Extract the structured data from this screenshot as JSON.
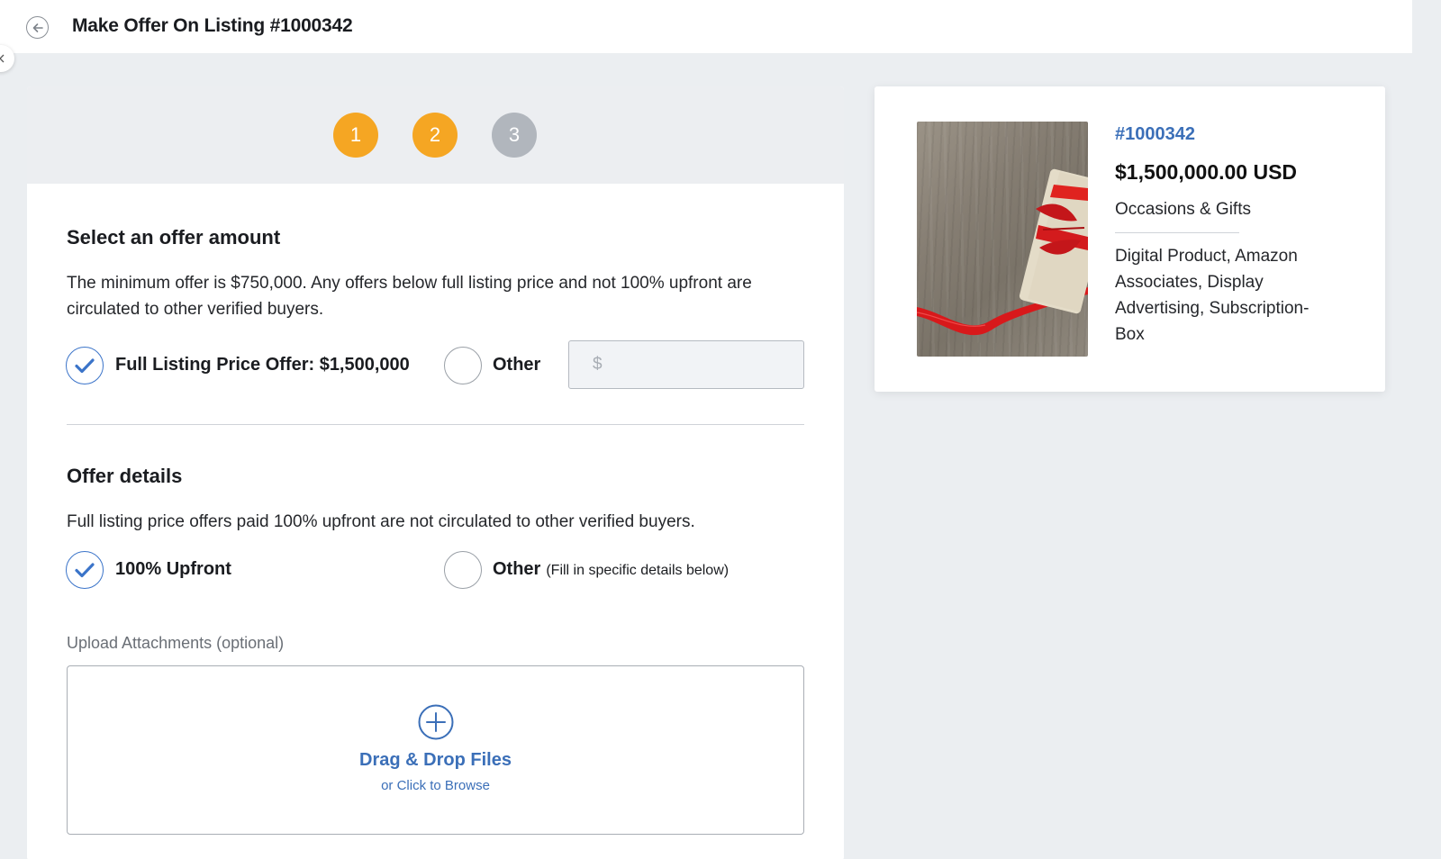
{
  "header": {
    "title": "Make Offer On Listing #1000342",
    "back_icon": "arrow-left-circle-icon"
  },
  "stepper": {
    "current_step": 2,
    "steps": [
      {
        "label": "1",
        "state": "complete"
      },
      {
        "label": "2",
        "state": "complete"
      },
      {
        "label": "3",
        "state": "pending"
      }
    ],
    "colors": {
      "complete": "#f5a623",
      "pending": "#b1b6bd"
    }
  },
  "offer_amount": {
    "title": "Select an offer amount",
    "description": "The minimum offer is $750,000. Any offers below full listing price and not 100% upfront are circulated to other verified buyers.",
    "options": {
      "full": {
        "label": "Full Listing Price Offer: $1,500,000",
        "checked": true
      },
      "other": {
        "label": "Other",
        "checked": false
      }
    },
    "other_input": {
      "placeholder": "$",
      "value": ""
    }
  },
  "offer_details": {
    "title": "Offer details",
    "description": "Full listing price offers paid 100% upfront are not circulated to other verified buyers.",
    "options": {
      "upfront": {
        "label": "100% Upfront",
        "checked": true
      },
      "other": {
        "label": "Other",
        "hint": "(Fill in specific details below)",
        "checked": false
      }
    }
  },
  "upload": {
    "label": "Upload Attachments (optional)",
    "main_text": "Drag & Drop Files",
    "sub_text": "or Click to Browse",
    "icon": "plus-circle-icon"
  },
  "listing": {
    "id": "#1000342",
    "price": "$1,500,000.00 USD",
    "category": "Occasions & Gifts",
    "models": "Digital Product, Amazon Associates, Display Advertising, Subscription-Box",
    "image": "gift-box-on-wood-image"
  },
  "colors": {
    "accent": "#3b74c9",
    "link": "#3b6fb8",
    "step_complete": "#f5a623",
    "page_bg": "#ebeef1"
  }
}
